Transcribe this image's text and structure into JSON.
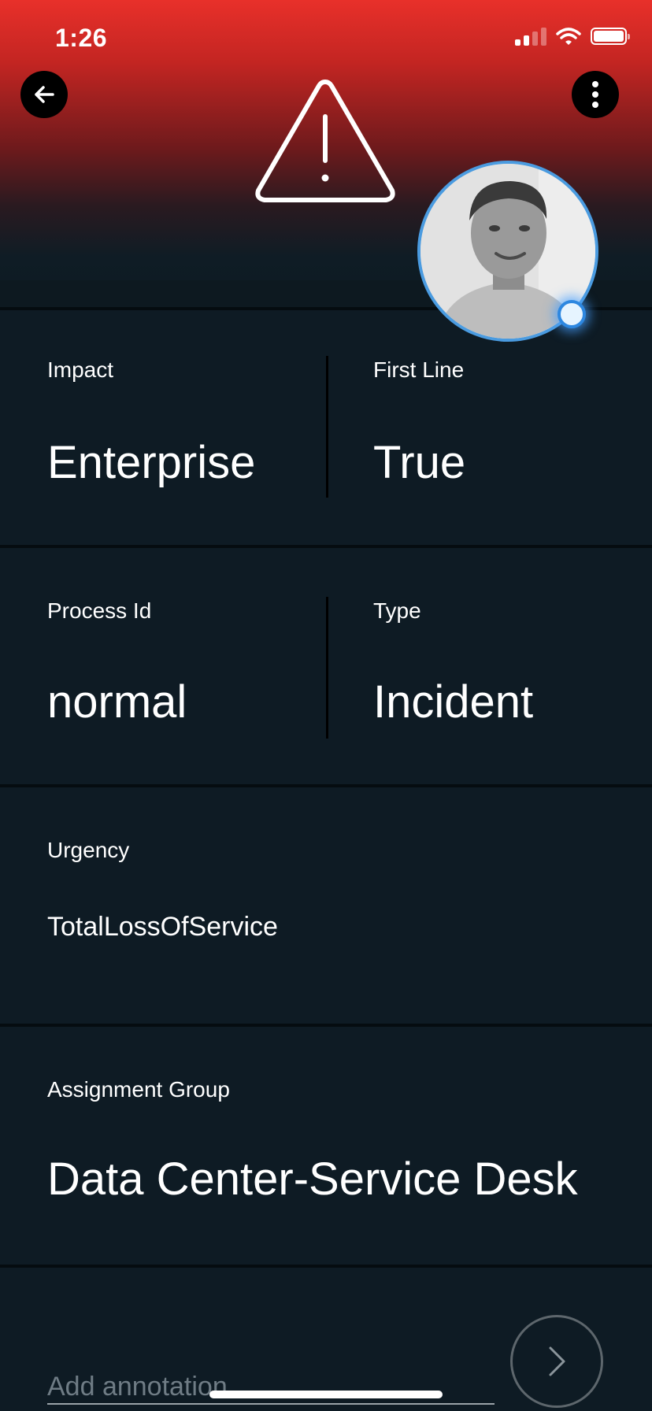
{
  "status_bar": {
    "time": "1:26"
  },
  "header": {
    "back_icon": "arrow-left-icon",
    "more_icon": "more-vertical-icon",
    "alert_icon": "warning-triangle-icon",
    "avatar_status": "online"
  },
  "details": {
    "impact": {
      "label": "Impact",
      "value": "Enterprise"
    },
    "first_line": {
      "label": "First Line",
      "value": "True"
    },
    "process_id": {
      "label": "Process Id",
      "value": "normal"
    },
    "type": {
      "label": "Type",
      "value": "Incident"
    },
    "urgency": {
      "label": "Urgency",
      "value": "TotalLossOfService"
    },
    "assignment_group": {
      "label": "Assignment Group",
      "value": "Data Center-Service Desk"
    }
  },
  "annotation": {
    "placeholder": "Add annotation",
    "value": ""
  },
  "colors": {
    "header_top": "#e8302a",
    "background": "#0e1b24",
    "avatar_ring": "#4a9be0",
    "presence": "#2d87e0"
  }
}
